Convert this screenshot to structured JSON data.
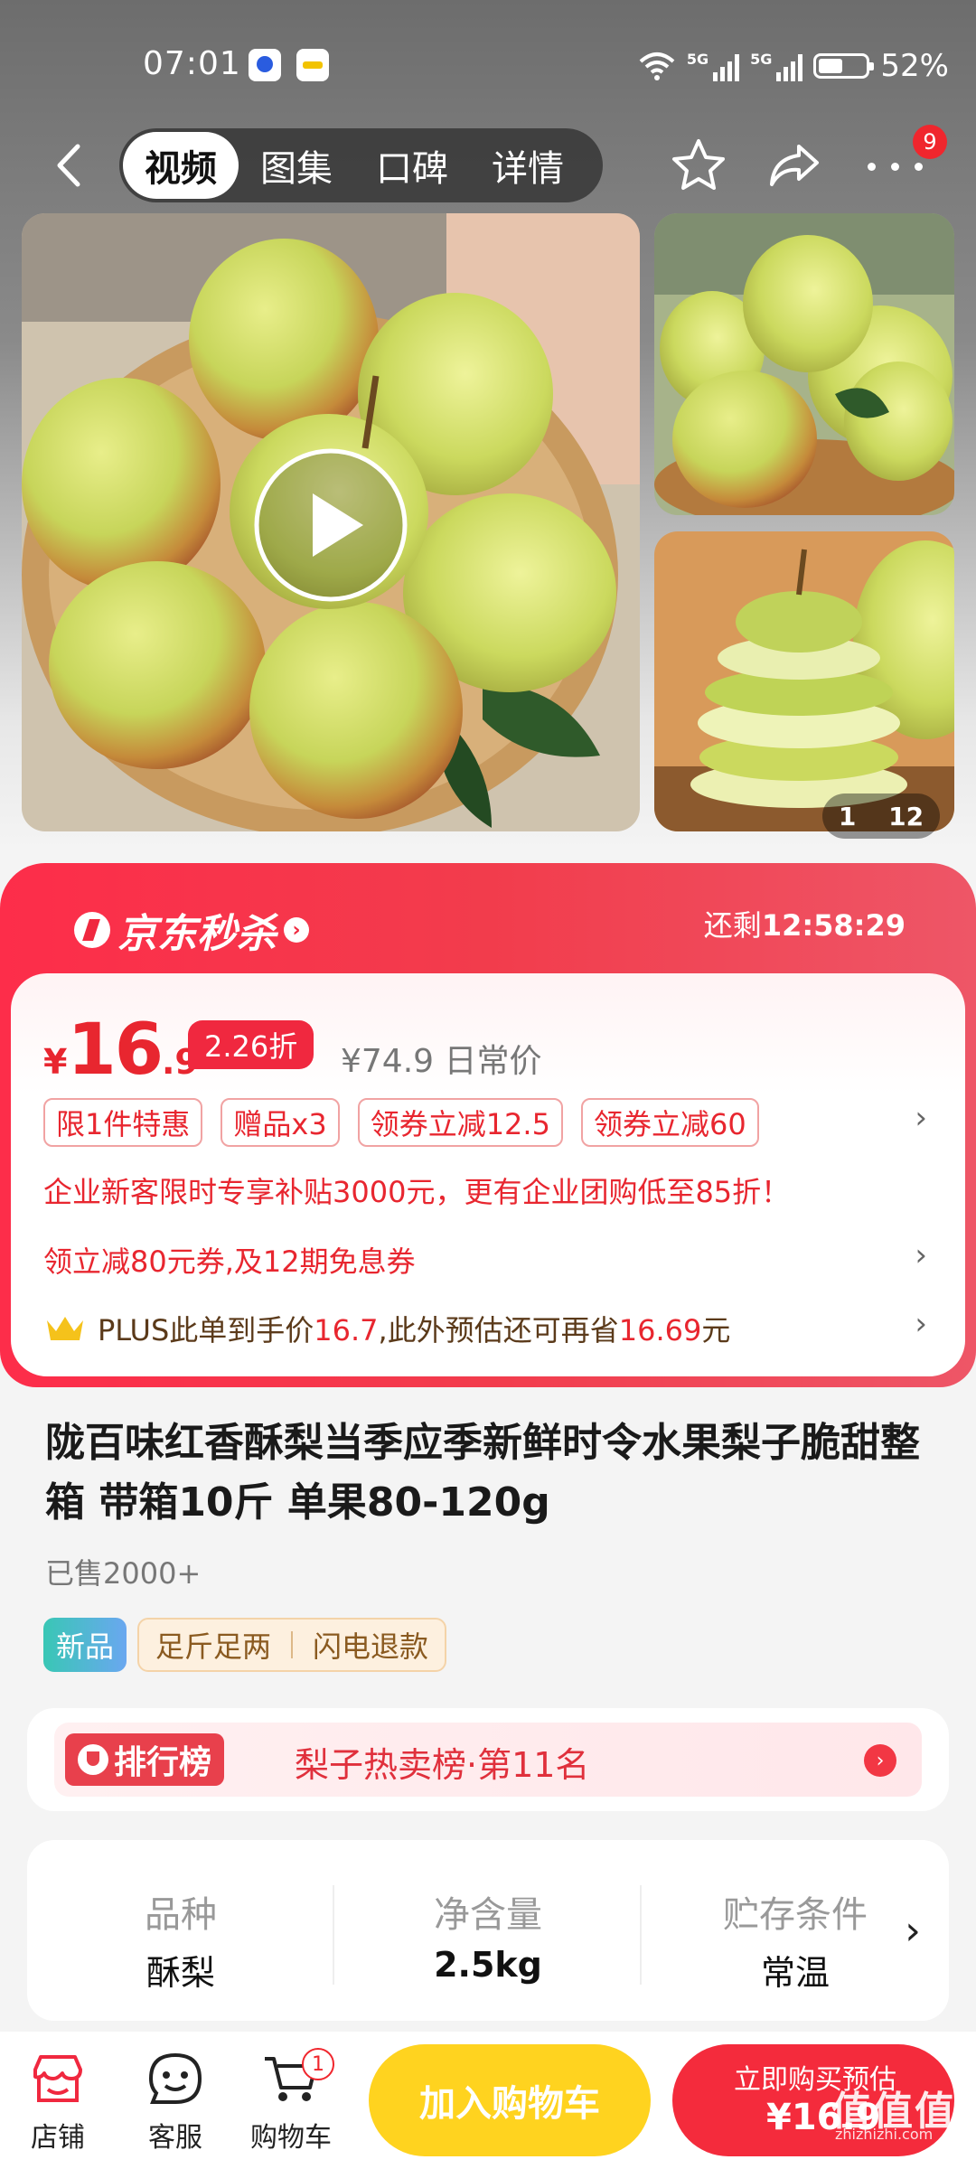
{
  "status_bar": {
    "time": "07:01",
    "signal1_label": "5G",
    "signal2_label": "5G",
    "battery": "52%",
    "icons": [
      "baidu-app-icon",
      "realme-app-icon",
      "wifi-icon",
      "signal-icon",
      "battery-icon"
    ]
  },
  "nav": {
    "tabs": [
      "视频",
      "图集",
      "口碑",
      "详情"
    ],
    "active_tab": "视频",
    "more_badge": "9",
    "icons": [
      "back-arrow-icon",
      "star-icon",
      "share-icon",
      "more-dots-icon"
    ]
  },
  "gallery": {
    "current": "1",
    "total": "12",
    "play_icon": "play-icon"
  },
  "flash_sale": {
    "title": "京东秒杀",
    "countdown_label": "还剩",
    "countdown": "12:58:29",
    "price_symbol": "¥",
    "price_int": "16",
    "price_dec": ".9",
    "discount": "2.26折",
    "orig_price": "¥74.9 日常价",
    "coupons": [
      "限1件特惠",
      "赠品x3",
      "领券立减12.5",
      "领券立减60"
    ],
    "enterprise_line": "企业新客限时专享补贴3000元，更有企业团购低至85折！",
    "coupon_line": "领立减80元券,及12期免息券",
    "plus": {
      "text_a": "PLUS此单到手价",
      "price_a": "16.7",
      "text_b": ",此外预估还可再省",
      "price_b": "16.69",
      "text_c": "元"
    },
    "accent_color": "#f0283f"
  },
  "product": {
    "title": "陇百味红香酥梨当季应季新鲜时令水果梨子脆甜整箱 带箱10斤 单果80-120g",
    "sold": "已售2000+",
    "tag_new": "新品",
    "tags": [
      "足斤足两",
      "闪电退款"
    ]
  },
  "ranking": {
    "badge": "排行榜",
    "text": "梨子热卖榜·第11名"
  },
  "specs": [
    {
      "label": "品种",
      "value": "酥梨"
    },
    {
      "label": "净含量",
      "value": "2.5kg"
    },
    {
      "label": "贮存条件",
      "value": "常温"
    }
  ],
  "bottom_bar": {
    "store": "店铺",
    "service": "客服",
    "cart": "购物车",
    "cart_count": "1",
    "add_cart": "加入购物车",
    "buy_line1": "立即购买预估",
    "buy_line2": "¥16.9"
  },
  "watermark": {
    "logo": "值值值",
    "site": "zhizhizhi.com"
  }
}
